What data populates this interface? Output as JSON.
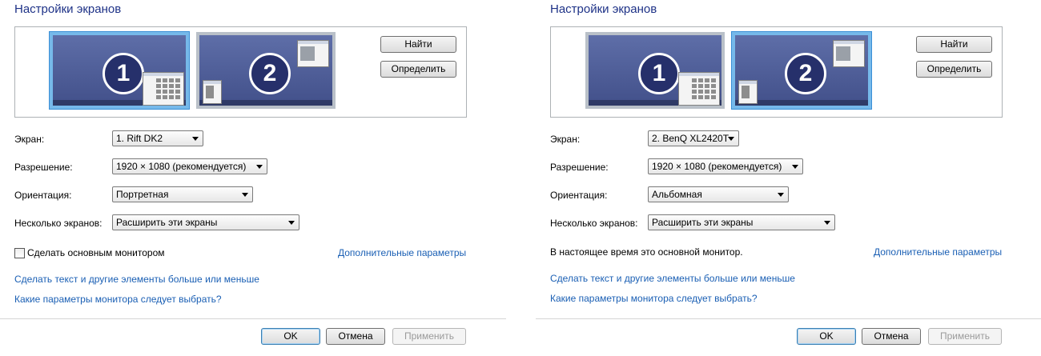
{
  "panels": [
    {
      "title": "Настройки экранов",
      "monitors": [
        {
          "number": "1",
          "selected": true
        },
        {
          "number": "2",
          "selected": false
        }
      ],
      "find_button": "Найти",
      "identify_button": "Определить",
      "display_label": "Экран:",
      "display_value": "1. Rift DK2",
      "resolution_label": "Разрешение:",
      "resolution_value": "1920 × 1080 (рекомендуется)",
      "orientation_label": "Ориентация:",
      "orientation_value": "Портретная",
      "multiple_label": "Несколько экранов:",
      "multiple_value": "Расширить эти экраны",
      "primary_checkbox_label": "Сделать основным монитором",
      "advanced_link": "Дополнительные параметры",
      "text_size_link": "Сделать текст и другие элементы больше или меньше",
      "which_settings_link": "Какие параметры монитора следует выбрать?",
      "ok_button": "OK",
      "cancel_button": "Отмена",
      "apply_button": "Применить"
    },
    {
      "title": "Настройки экранов",
      "monitors": [
        {
          "number": "1",
          "selected": false
        },
        {
          "number": "2",
          "selected": true
        }
      ],
      "find_button": "Найти",
      "identify_button": "Определить",
      "display_label": "Экран:",
      "display_value": "2. BenQ XL2420T",
      "resolution_label": "Разрешение:",
      "resolution_value": "1920 × 1080 (рекомендуется)",
      "orientation_label": "Ориентация:",
      "orientation_value": "Альбомная",
      "multiple_label": "Несколько экранов:",
      "multiple_value": "Расширить эти экраны",
      "primary_status": "В настоящее время это основной монитор.",
      "advanced_link": "Дополнительные параметры",
      "text_size_link": "Сделать текст и другие элементы больше или меньше",
      "which_settings_link": "Какие параметры монитора следует выбрать?",
      "ok_button": "OK",
      "cancel_button": "Отмена",
      "apply_button": "Применить"
    }
  ],
  "colors": {
    "title": "#1e3287",
    "link": "#1a5fb4",
    "monitor_fill": "#4c5a94",
    "selection": "#76b9ea"
  }
}
